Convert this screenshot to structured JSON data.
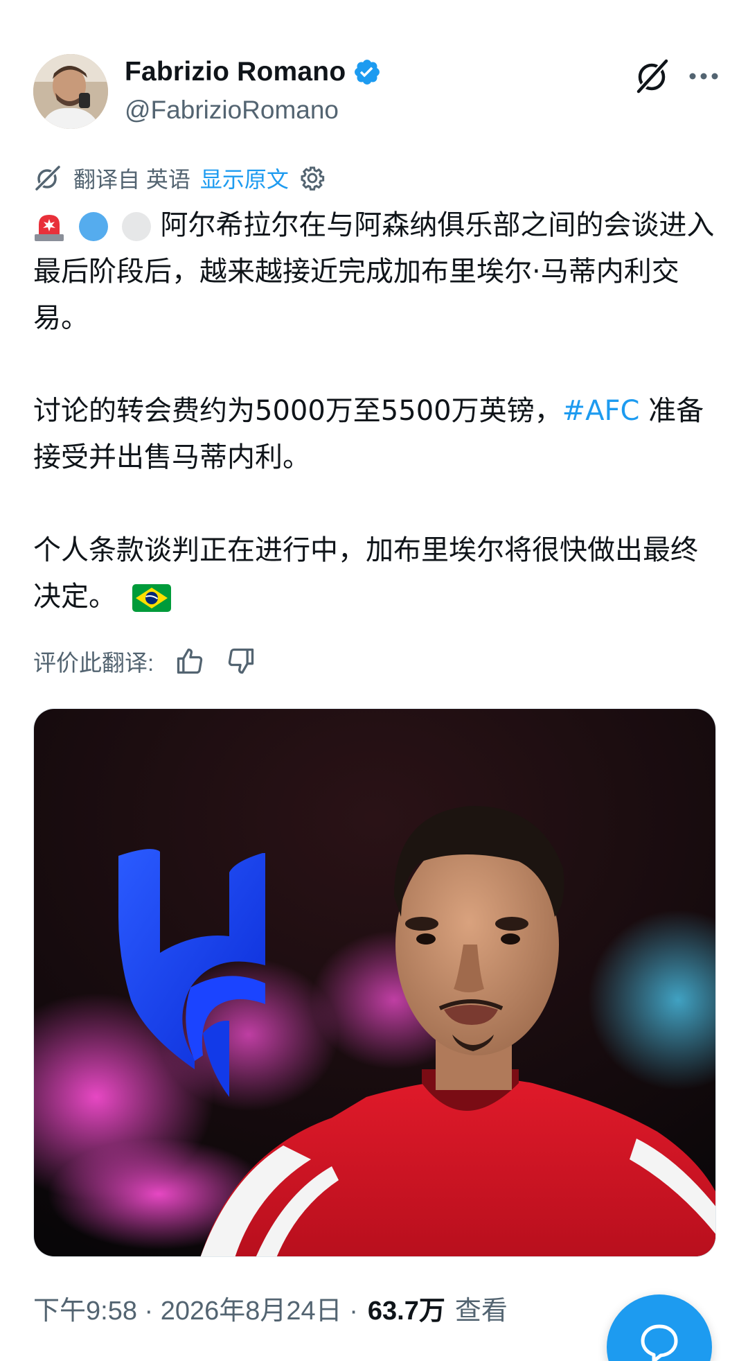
{
  "author": {
    "name": "Fabrizio Romano",
    "handle": "@FabrizioRomano",
    "verified": true
  },
  "translation": {
    "label": "翻译自 英语",
    "show_original": "显示原文",
    "rate_label": "评价此翻译:"
  },
  "tweet": {
    "paragraphs": [
      "阿尔希拉尔在与阿森纳俱乐部之间的会谈进入最后阶段后，越来越接近完成加布里埃尔·马蒂内利交易。",
      "讨论的转会费约为5000万至5500万英镑，",
      "#AFC",
      " 准备接受并出售马蒂内利。",
      "个人条款谈判正在进行中，加布里埃尔将很快做出最终决定。"
    ]
  },
  "footer": {
    "time": "下午9:58 · 2026年8月24日 ·",
    "views": "63.7万",
    "views_label": "查看"
  },
  "colors": {
    "accent": "#1d9bf0",
    "text_primary": "#0f1419",
    "text_secondary": "#536471"
  },
  "icons": [
    "verified-badge-icon",
    "grok-icon",
    "more-icon",
    "translate-icon",
    "gear-icon",
    "thumbs-up-icon",
    "thumbs-down-icon",
    "reply-bubble-icon"
  ]
}
